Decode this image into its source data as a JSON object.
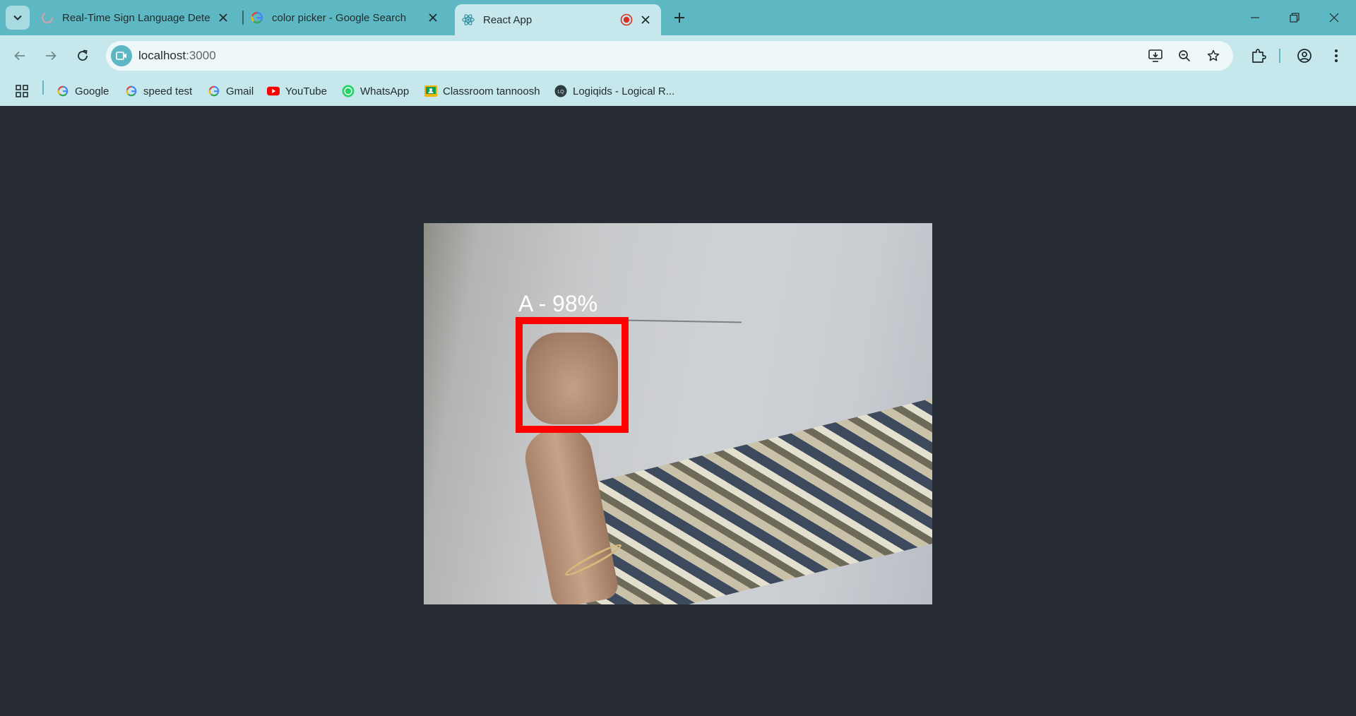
{
  "browser": {
    "tabs": [
      {
        "title": "Real-Time Sign Language Detec",
        "icon": "loading-icon",
        "active": false
      },
      {
        "title": "color picker - Google Search",
        "icon": "google-icon",
        "active": false
      },
      {
        "title": "React App",
        "icon": "react-icon",
        "active": true,
        "recording": true
      }
    ],
    "url": {
      "host": "localhost",
      "port": ":3000"
    },
    "bookmarks": [
      {
        "label": "Google",
        "icon": "google-icon"
      },
      {
        "label": "speed test",
        "icon": "google-icon"
      },
      {
        "label": "Gmail",
        "icon": "google-icon"
      },
      {
        "label": "YouTube",
        "icon": "youtube-icon"
      },
      {
        "label": "WhatsApp",
        "icon": "whatsapp-icon"
      },
      {
        "label": "Classroom tannoosh",
        "icon": "classroom-icon"
      },
      {
        "label": "Logiqids - Logical R...",
        "icon": "logiqids-icon"
      }
    ]
  },
  "app": {
    "detection": {
      "label": "A - 98%",
      "box_color": "#ff0000"
    }
  },
  "colors": {
    "tabstrip": "#5eb8c3",
    "toolbar": "#c6e8ec",
    "page_background": "#282c34"
  }
}
